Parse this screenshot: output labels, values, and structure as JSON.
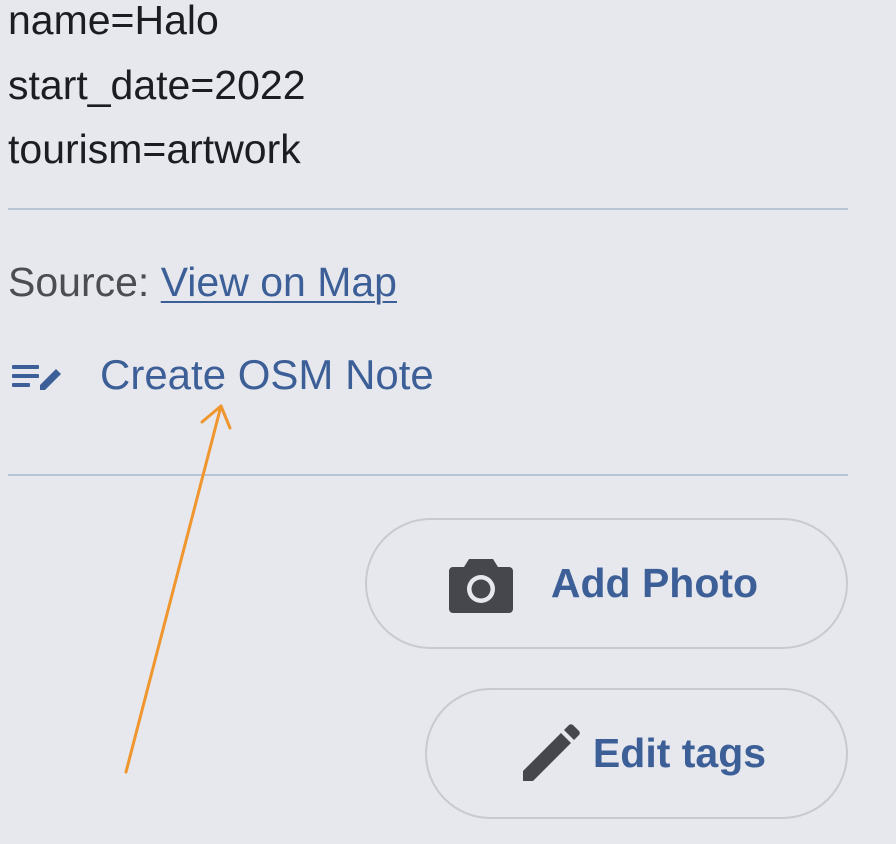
{
  "tags": [
    "name=Halo",
    "start_date=2022",
    "tourism=artwork"
  ],
  "source": {
    "prefix": "Source: ",
    "link_label": "View on Map"
  },
  "note": {
    "icon": "edit-note-icon",
    "label": "Create OSM Note"
  },
  "actions": {
    "add_photo": {
      "icon": "camera-icon",
      "label": "Add Photo"
    },
    "edit_tags": {
      "icon": "pencil-icon",
      "label": "Edit tags"
    }
  },
  "annotation": {
    "type": "arrow",
    "points_to": "Create OSM Note",
    "color": "#f0962e"
  },
  "colors": {
    "background": "#e7e8ee",
    "link": "#3d5f97",
    "divider": "#b8c4d6",
    "icon": "#45474d"
  }
}
